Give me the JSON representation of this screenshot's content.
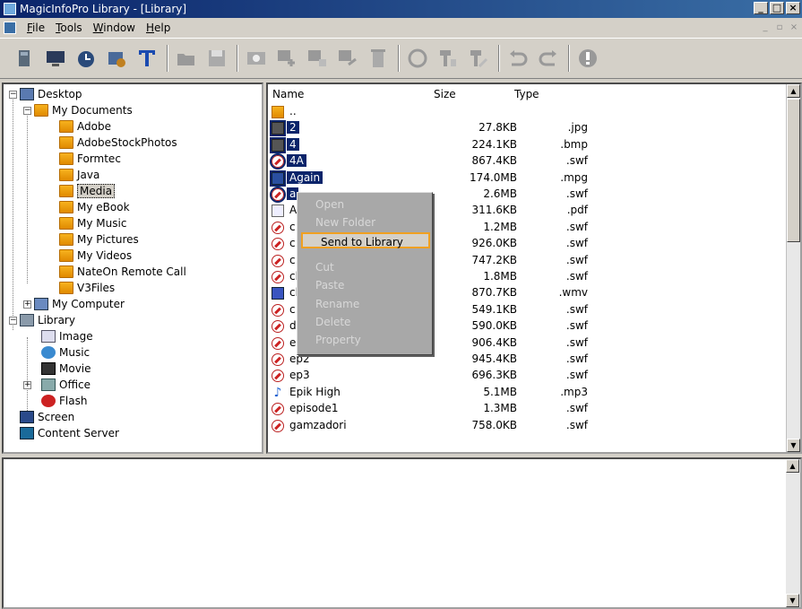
{
  "window": {
    "title": "MagicInfoPro Library - [Library]",
    "min": "_",
    "max": "□",
    "close": "×"
  },
  "menu": [
    {
      "label": "File",
      "u": "F",
      "rest": "ile"
    },
    {
      "label": "Tools",
      "u": "T",
      "rest": "ools"
    },
    {
      "label": "Window",
      "u": "W",
      "rest": "indow"
    },
    {
      "label": "Help",
      "u": "H",
      "rest": "elp"
    }
  ],
  "toolbar_icons": [
    "library-icon",
    "monitor-icon",
    "schedule-icon",
    "settings-icon",
    "text-icon",
    "open-folder-icon",
    "save-icon",
    "preview-icon",
    "add-icon",
    "edit-icon",
    "move-icon",
    "delete-icon",
    "refresh-icon",
    "send-icon",
    "receive-icon",
    "undo-icon",
    "redo-icon",
    "info-icon"
  ],
  "tree": {
    "desktop": "Desktop",
    "my_documents": "My Documents",
    "folders": [
      "Adobe",
      "AdobeStockPhotos",
      "Formtec",
      "Java",
      "Media",
      "My eBook",
      "My Music",
      "My Pictures",
      "My Videos",
      "NateOn Remote Call",
      "V3Files"
    ],
    "my_computer": "My Computer",
    "library": "Library",
    "library_items": [
      "Image",
      "Music",
      "Movie",
      "Office",
      "Flash"
    ],
    "screen": "Screen",
    "content_server": "Content Server"
  },
  "filelist": {
    "headers": {
      "name": "Name",
      "size": "Size",
      "type": "Type"
    },
    "rows": [
      {
        "name": "..",
        "size": "",
        "type": "",
        "icon": "folder",
        "sel": false
      },
      {
        "name": "2",
        "size": "27.8KB",
        "type": ".jpg",
        "icon": "img",
        "sel": true
      },
      {
        "name": "4",
        "size": "224.1KB",
        "type": ".bmp",
        "icon": "img",
        "sel": true
      },
      {
        "name": "4A",
        "size": "867.4KB",
        "type": ".swf",
        "icon": "swf",
        "sel": true
      },
      {
        "name": "Again",
        "size": "174.0MB",
        "type": ".mpg",
        "icon": "mpg",
        "sel": true
      },
      {
        "name": "a",
        "size": "2.6MB",
        "type": ".swf",
        "icon": "swf",
        "sel": true
      },
      {
        "name": "A",
        "size": "311.6KB",
        "type": ".pdf",
        "icon": "doc",
        "sel": false
      },
      {
        "name": "c",
        "size": "1.2MB",
        "type": ".swf",
        "icon": "swf",
        "sel": false
      },
      {
        "name": "c",
        "size": "926.0KB",
        "type": ".swf",
        "icon": "swf",
        "sel": false
      },
      {
        "name": "c",
        "size": "747.2KB",
        "type": ".swf",
        "icon": "swf",
        "sel": false
      },
      {
        "name": "cl",
        "size": "1.8MB",
        "type": ".swf",
        "icon": "swf",
        "sel": false
      },
      {
        "name": "cl",
        "size": "870.7KB",
        "type": ".wmv",
        "icon": "wmv",
        "sel": false
      },
      {
        "name": "c",
        "size": "549.1KB",
        "type": ".swf",
        "icon": "swf",
        "sel": false
      },
      {
        "name": "d",
        "size": "590.0KB",
        "type": ".swf",
        "icon": "swf",
        "sel": false
      },
      {
        "name": "ep",
        "size": "906.4KB",
        "type": ".swf",
        "icon": "swf",
        "sel": false
      },
      {
        "name": "ep2",
        "size": "945.4KB",
        "type": ".swf",
        "icon": "swf",
        "sel": false
      },
      {
        "name": "ep3",
        "size": "696.3KB",
        "type": ".swf",
        "icon": "swf",
        "sel": false
      },
      {
        "name": "Epik High",
        "size": "5.1MB",
        "type": ".mp3",
        "icon": "mp3",
        "sel": false
      },
      {
        "name": "episode1",
        "size": "1.3MB",
        "type": ".swf",
        "icon": "swf",
        "sel": false
      },
      {
        "name": "gamzadori",
        "size": "758.0KB",
        "type": ".swf",
        "icon": "swf",
        "sel": false
      }
    ]
  },
  "context_menu": [
    {
      "label": "Open",
      "enabled": false
    },
    {
      "label": "New Folder",
      "enabled": false
    },
    {
      "label": "Send to Library",
      "enabled": true
    },
    {
      "label": "Cut",
      "enabled": false
    },
    {
      "label": "Paste",
      "enabled": false
    },
    {
      "label": "Rename",
      "enabled": false
    },
    {
      "label": "Delete",
      "enabled": false
    },
    {
      "label": "Property",
      "enabled": false
    }
  ],
  "colors": {
    "selection": "#0a246a",
    "highlight_border": "#f0a020",
    "chrome": "#d4d0c8"
  }
}
